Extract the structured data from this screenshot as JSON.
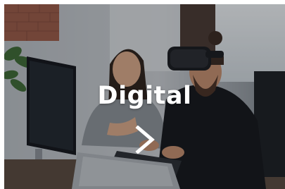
{
  "card": {
    "title": "Digital",
    "arrow_icon": "chevron-right-icon"
  },
  "colors": {
    "text": "#ffffff",
    "overlay": "#0a0e16"
  }
}
